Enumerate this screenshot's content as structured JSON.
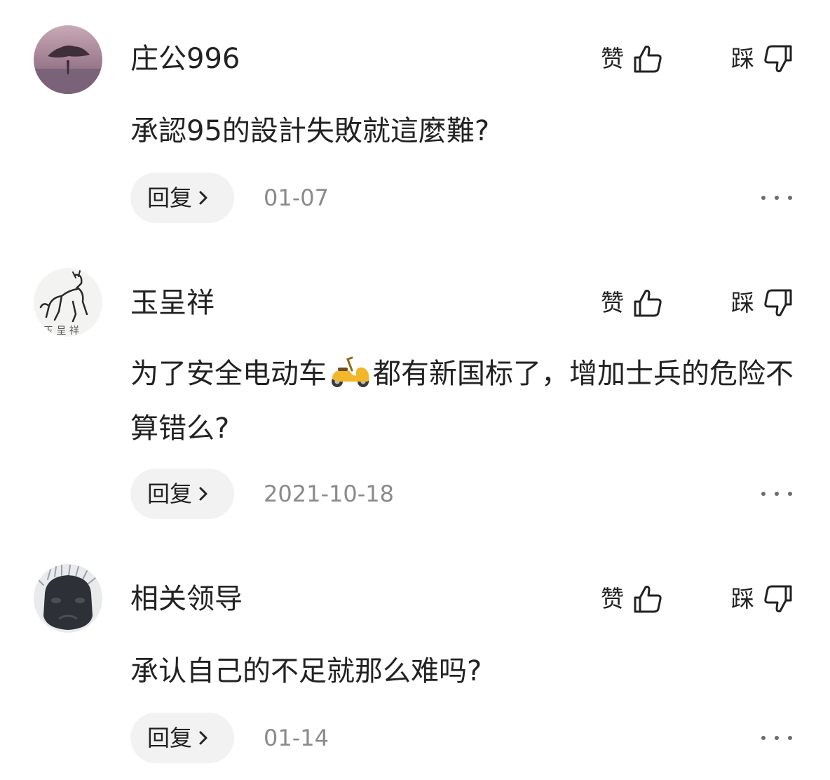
{
  "labels": {
    "like": "赞",
    "dislike": "踩",
    "reply": "回复"
  },
  "comments": [
    {
      "username": "庄公996",
      "avatar": "tree-landscape-avatar",
      "text": "承認95的設計失敗就這麼難?",
      "date": "01-07"
    },
    {
      "username": "玉呈祥",
      "avatar": "ink-horse-avatar",
      "text_before_emoji": "为了安全电动车",
      "emoji": "scooter-emoji",
      "text_after_emoji": "都有新国标了，增加士兵的危险不算错么?",
      "date": "2021-10-18"
    },
    {
      "username": "相关领导",
      "avatar": "dark-mask-avatar",
      "text": "承认自己的不足就那么难吗?",
      "date": "01-14"
    }
  ],
  "icons": {
    "like": "thumbs-up-icon",
    "dislike": "thumbs-down-icon",
    "chevron": "chevron-right-icon",
    "more": "more-icon"
  }
}
